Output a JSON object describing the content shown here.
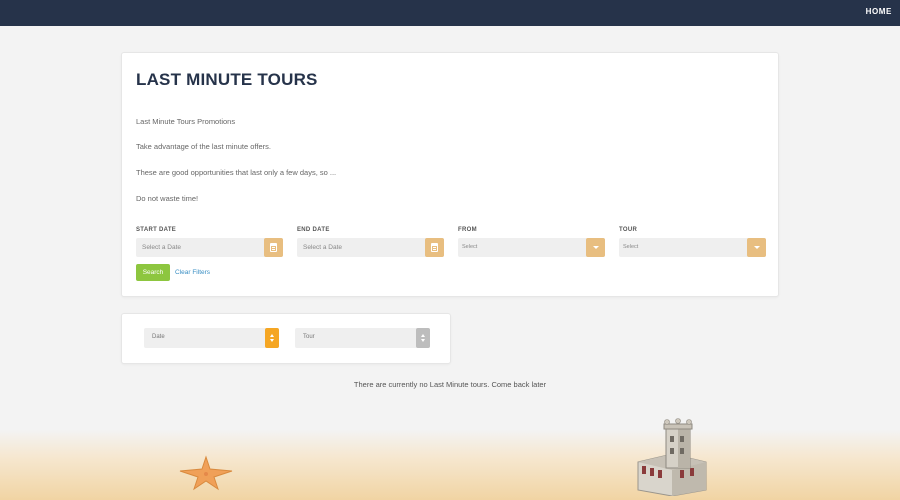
{
  "navbar": {
    "home_label": "HOME",
    "background": "#26334a"
  },
  "promo": {
    "title": "LAST MINUTE TOURS",
    "paragraphs": [
      "Last Minute Tours Promotions",
      "Take advantage of the last minute offers.",
      "These are good opportunities that last only a few days, so ...",
      "Do not waste time!"
    ]
  },
  "filters": {
    "start_date": {
      "label": "START DATE",
      "placeholder": "Select a Date",
      "icon": "calendar-icon"
    },
    "end_date": {
      "label": "END DATE",
      "placeholder": "Select a Date",
      "icon": "calendar-icon"
    },
    "from": {
      "label": "FROM",
      "value": "Select",
      "icon": "chevron-down-icon"
    },
    "tour": {
      "label": "TOUR",
      "value": "Select",
      "icon": "chevron-down-icon"
    },
    "search_label": "Search",
    "clear_label": "Clear Filters",
    "accent_color": "#e8be80",
    "search_color": "#8dc63f"
  },
  "sort": {
    "primary": {
      "value": "Date",
      "color": "#f5a623"
    },
    "secondary": {
      "value": "Tour",
      "color": "#bdbdbd"
    }
  },
  "results": {
    "empty_message": "There are currently no Last Minute tours. Come back later"
  }
}
